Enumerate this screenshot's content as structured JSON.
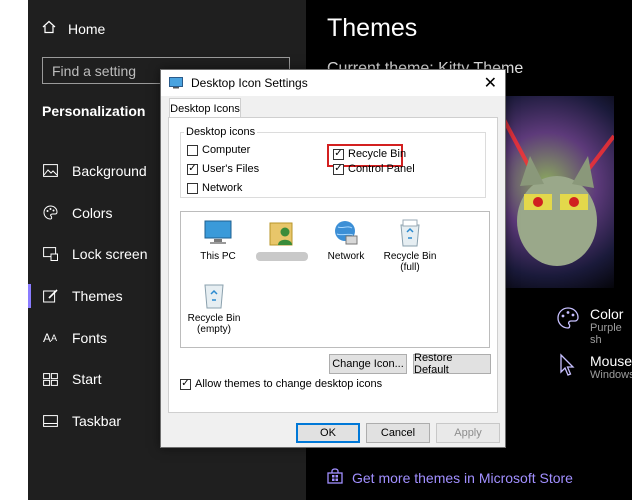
{
  "sidebar": {
    "home_label": "Home",
    "search_placeholder": "Find a setting",
    "section_title": "Personalization",
    "items": [
      {
        "label": "Background",
        "icon": "image-icon"
      },
      {
        "label": "Colors",
        "icon": "palette-icon"
      },
      {
        "label": "Lock screen",
        "icon": "lock-screen-icon"
      },
      {
        "label": "Themes",
        "icon": "brush-icon",
        "active": true
      },
      {
        "label": "Fonts",
        "icon": "font-icon"
      },
      {
        "label": "Start",
        "icon": "start-icon"
      },
      {
        "label": "Taskbar",
        "icon": "taskbar-icon"
      }
    ]
  },
  "main": {
    "title": "Themes",
    "current_theme": "Current theme: Kitty Theme",
    "color_label": "Color",
    "color_sub": "Purple sh",
    "mouse_label": "Mouse",
    "mouse_sub": "Windows",
    "store_link": "Get more themes in Microsoft Store"
  },
  "dialog": {
    "title": "Desktop Icon Settings",
    "tab": "Desktop Icons",
    "group_label": "Desktop icons",
    "checkboxes": [
      {
        "label": "Computer",
        "checked": false
      },
      {
        "label": "User's Files",
        "checked": true
      },
      {
        "label": "Network",
        "checked": false
      },
      {
        "label": "Recycle Bin",
        "checked": true
      },
      {
        "label": "Control Panel",
        "checked": true
      }
    ],
    "icons": [
      {
        "label": "This PC"
      },
      {
        "label": "Network"
      },
      {
        "label": "Recycle Bin\n(full)"
      },
      {
        "label": "Recycle Bin\n(empty)"
      }
    ],
    "change_icon": "Change Icon...",
    "restore_default": "Restore Default",
    "allow_themes": "Allow themes to change desktop icons",
    "ok": "OK",
    "cancel": "Cancel",
    "apply": "Apply"
  }
}
